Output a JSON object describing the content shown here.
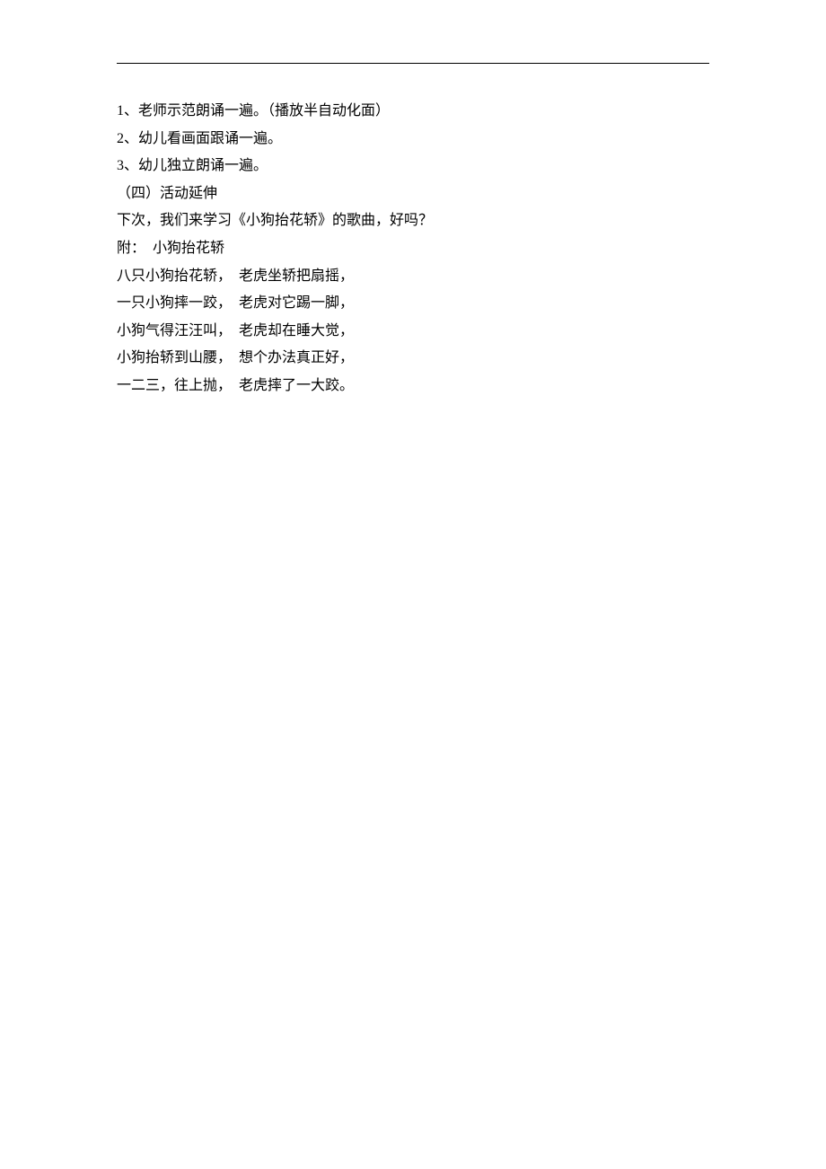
{
  "lines": [
    "1、老师示范朗诵一遍。（播放半自动化面）",
    "2、幼儿看画面跟诵一遍。",
    "3、幼儿独立朗诵一遍。",
    "（四）活动延伸",
    "下次，我们来学习《小狗抬花轿》的歌曲，好吗？",
    "附：  小狗抬花轿",
    "八只小狗抬花轿，  老虎坐轿把扇摇，",
    "一只小狗摔一跤，  老虎对它踢一脚，",
    "小狗气得汪汪叫，  老虎却在睡大觉，",
    "小狗抬轿到山腰，  想个办法真正好，",
    "一二三，往上抛，  老虎摔了一大跤。"
  ]
}
